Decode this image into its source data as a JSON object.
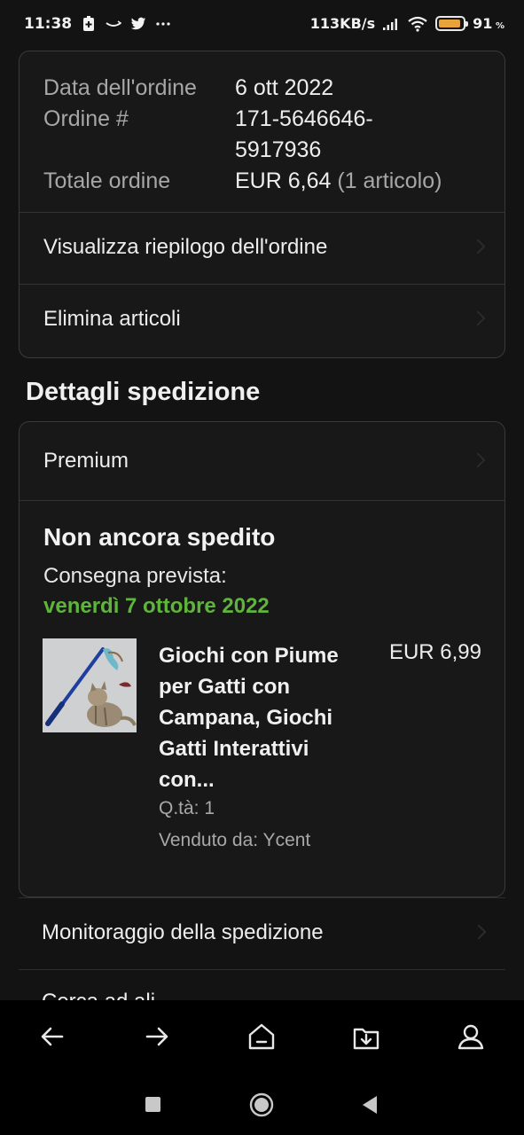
{
  "status_bar": {
    "time": "11:38",
    "net_speed": "113KB/s",
    "battery_percent": "91",
    "battery_level": 0.91,
    "percent_symbol": "%",
    "battery_color": "#e8a33a"
  },
  "order_info": {
    "rows": [
      {
        "label": "Data dell'ordine",
        "value": "6 ott 2022"
      },
      {
        "label": "Ordine #",
        "value": "171-5646646-\n5917936"
      },
      {
        "label": "Totale ordine",
        "value": "EUR 6,64",
        "extra": "(1 articolo)"
      }
    ],
    "links": [
      {
        "label": "Visualizza riepilogo dell'ordine"
      },
      {
        "label": "Elimina articoli"
      }
    ]
  },
  "shipping": {
    "section_title": "Dettagli spedizione",
    "shipping_method": "Premium",
    "status": "Non ancora spedito",
    "delivery_label": "Consegna prevista:",
    "delivery_date": "venerdì 7 ottobre 2022",
    "delivery_color": "#5fb53c",
    "product": {
      "title": "Giochi con Piume per Gatti con Campana, Giochi Gatti Interattivi con...",
      "price": "EUR 6,99",
      "quantity": "Q.tà: 1",
      "seller": "Venduto da: Ycent",
      "image": "cat-feather-toy-image"
    }
  },
  "actions": {
    "track": "Monitoraggio della spedizione",
    "partial_next": "Cerca ad ali..."
  },
  "toolbar": {
    "icons": [
      "back-arrow-icon",
      "forward-arrow-icon",
      "home-icon",
      "downloads-icon",
      "profile-icon"
    ]
  },
  "nav_bar": {
    "icons": [
      "recents-square-icon",
      "home-circle-icon",
      "back-triangle-icon"
    ]
  }
}
